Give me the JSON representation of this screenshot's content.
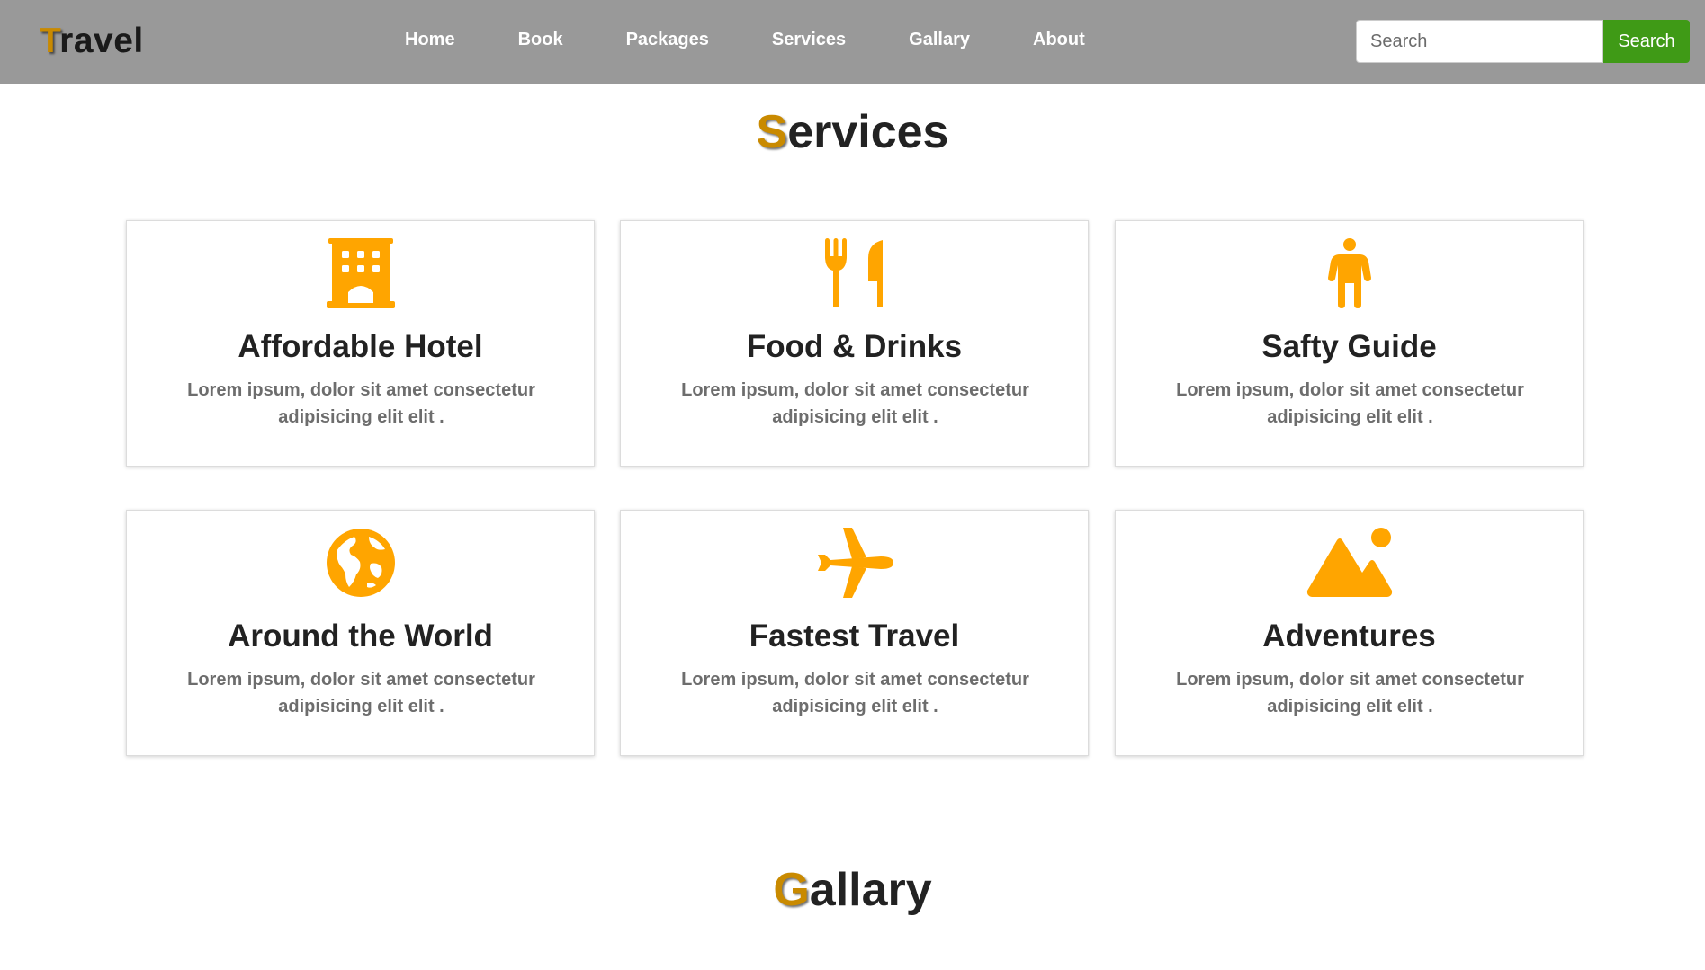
{
  "navbar": {
    "brand_first": "T",
    "brand_rest": "ravel",
    "links": [
      {
        "label": "Home"
      },
      {
        "label": "Book"
      },
      {
        "label": "Packages"
      },
      {
        "label": "Services"
      },
      {
        "label": "Gallary"
      },
      {
        "label": "About"
      }
    ],
    "search_placeholder": "Search",
    "search_button_label": "Search"
  },
  "services": {
    "heading_first": "S",
    "heading_rest": "ervices",
    "cards": [
      {
        "icon": "hotel-icon",
        "title": "Affordable Hotel",
        "text": "Lorem ipsum, dolor sit amet consectetur adipisicing elit elit ."
      },
      {
        "icon": "utensils-icon",
        "title": "Food & Drinks",
        "text": "Lorem ipsum, dolor sit amet consectetur adipisicing elit elit ."
      },
      {
        "icon": "person-icon",
        "title": "Safty Guide",
        "text": "Lorem ipsum, dolor sit amet consectetur adipisicing elit elit ."
      },
      {
        "icon": "globe-icon",
        "title": "Around the World",
        "text": "Lorem ipsum, dolor sit amet consectetur adipisicing elit elit ."
      },
      {
        "icon": "plane-icon",
        "title": "Fastest Travel",
        "text": "Lorem ipsum, dolor sit amet consectetur adipisicing elit elit ."
      },
      {
        "icon": "mountain-icon",
        "title": "Adventures",
        "text": "Lorem ipsum, dolor sit amet consectetur adipisicing elit elit ."
      }
    ]
  },
  "gallery": {
    "heading_first": "G",
    "heading_rest": "allary"
  },
  "colors": {
    "navbar_bg": "#999999",
    "accent": "#c98a00",
    "icon": "#ffa500",
    "search_button": "#3f9a16"
  }
}
